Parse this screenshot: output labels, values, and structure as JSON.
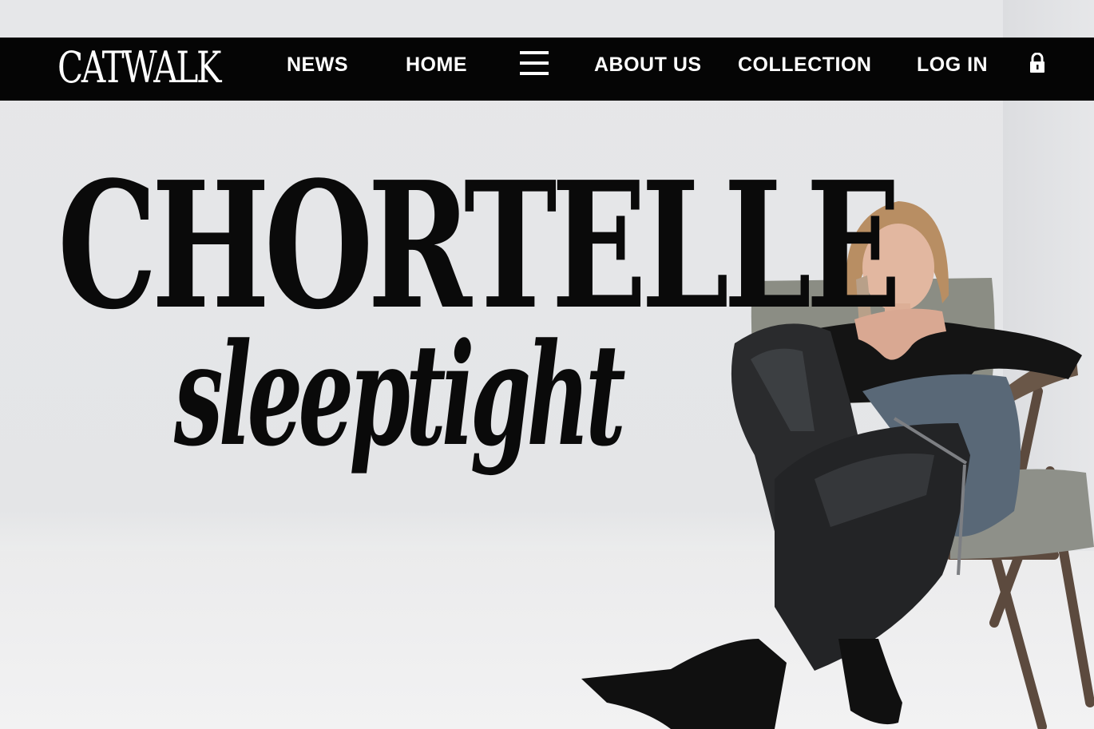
{
  "header": {
    "logo": "CATWALK",
    "nav": {
      "news": "NEWS",
      "home": "HOME",
      "about": "ABOUT US",
      "collection": "COLLECTION",
      "login": "LOG IN"
    },
    "icons": {
      "menu": "hamburger-menu-icon",
      "lock": "lock-icon"
    }
  },
  "hero": {
    "title": "CHORTELLE",
    "subtitle": "sleeptight"
  },
  "colors": {
    "navbar_bg": "#050505",
    "nav_text": "#ffffff",
    "page_bg": "#e6e7e9",
    "headline": "#0a0a0a"
  }
}
